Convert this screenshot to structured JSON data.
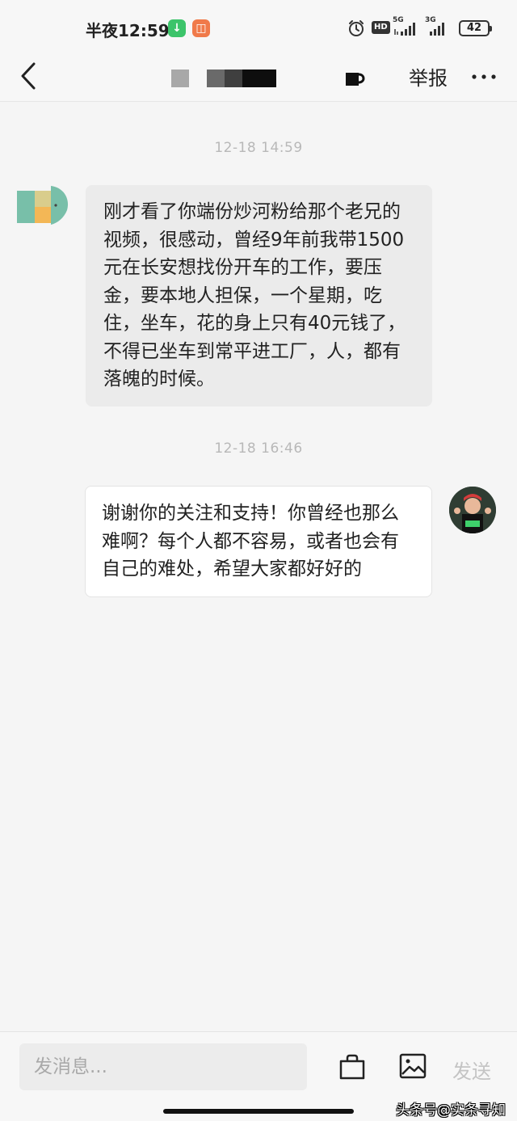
{
  "status_bar": {
    "time": "半夜12:59",
    "network_1": "5G",
    "network_2": "3G",
    "hd_label": "HD",
    "battery": "42"
  },
  "header": {
    "report_label": "举报"
  },
  "conversation": {
    "messages": [
      {
        "timestamp": "12-18 14:59",
        "direction": "incoming",
        "text": "刚才看了你端份炒河粉给那个老兄的视频，很感动，曾经9年前我带1500元在长安想找份开车的工作，要压金，要本地人担保，一个星期，吃住，坐车，花的身上只有40元钱了，不得已坐车到常平进工厂，人，都有落魄的时候。"
      },
      {
        "timestamp": "12-18 16:46",
        "direction": "outgoing",
        "text": "谢谢你的关注和支持！你曾经也那么难啊？每个人都不容易，或者也会有自己的难处，希望大家都好好的"
      }
    ]
  },
  "input_bar": {
    "placeholder": "发消息...",
    "send_label": "发送",
    "watermark": "头条号@实条寻知"
  },
  "colors": {
    "background": "#f5f5f5",
    "incoming_bubble": "#ebebeb",
    "outgoing_bubble": "#ffffff",
    "timestamp": "#b8b8b8",
    "send_disabled": "#c4c4c4"
  },
  "icons": {
    "back": "back-chevron-icon",
    "more": "more-dots-icon",
    "bag": "shopping-bag-icon",
    "image": "image-icon",
    "alarm": "alarm-clock-icon",
    "signal": "signal-icon"
  }
}
